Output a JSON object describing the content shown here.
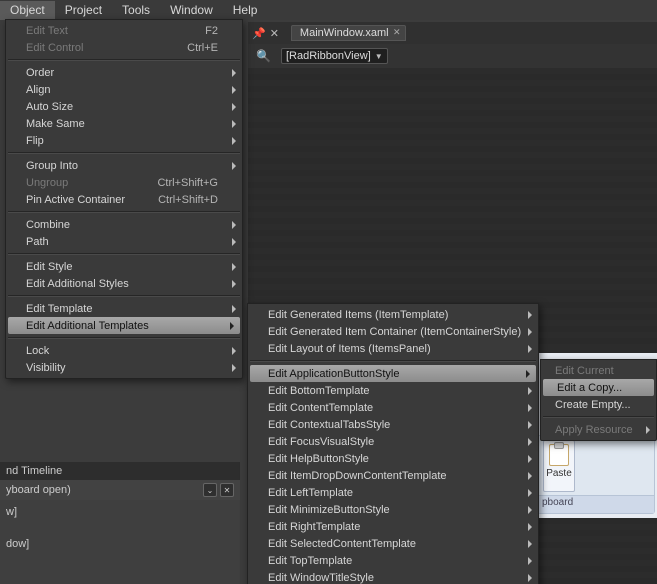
{
  "menubar": {
    "object": "Object",
    "project": "Project",
    "tools": "Tools",
    "window": "Window",
    "help": "Help"
  },
  "doc": {
    "tab_label": "MainWindow.xaml",
    "combo_value": "[RadRibbonView]"
  },
  "object_menu": {
    "edit_text": "Edit Text",
    "edit_text_sc": "F2",
    "edit_control": "Edit Control",
    "edit_control_sc": "Ctrl+E",
    "order": "Order",
    "align": "Align",
    "auto_size": "Auto Size",
    "make_same": "Make Same",
    "flip": "Flip",
    "group_into": "Group Into",
    "ungroup": "Ungroup",
    "ungroup_sc": "Ctrl+Shift+G",
    "pin_active": "Pin Active Container",
    "pin_active_sc": "Ctrl+Shift+D",
    "combine": "Combine",
    "path": "Path",
    "edit_style": "Edit Style",
    "edit_add_styles": "Edit Additional Styles",
    "edit_template": "Edit Template",
    "edit_add_templates": "Edit Additional Templates",
    "lock": "Lock",
    "visibility": "Visibility"
  },
  "templates_submenu": {
    "gen_items": "Edit Generated Items (ItemTemplate)",
    "gen_item_cont": "Edit Generated Item Container (ItemContainerStyle)",
    "layout_items": "Edit Layout of Items (ItemsPanel)",
    "app_button": "Edit ApplicationButtonStyle",
    "bottom": "Edit BottomTemplate",
    "content": "Edit ContentTemplate",
    "context_tabs": "Edit ContextualTabsStyle",
    "focus_visual": "Edit FocusVisualStyle",
    "help_button": "Edit HelpButtonStyle",
    "item_dropdown": "Edit ItemDropDownContentTemplate",
    "left": "Edit LeftTemplate",
    "minimize": "Edit MinimizeButtonStyle",
    "right": "Edit RightTemplate",
    "selected": "Edit SelectedContentTemplate",
    "top": "Edit TopTemplate",
    "window_title": "Edit WindowTitleStyle"
  },
  "style_submenu": {
    "edit_current": "Edit Current",
    "edit_copy": "Edit a Copy...",
    "create_empty": "Create Empty...",
    "apply_resource": "Apply Resource"
  },
  "timeline": {
    "header": "nd Timeline",
    "sub": "yboard open)",
    "row1": "w]",
    "row2": "dow]"
  },
  "ribbon": {
    "paste": "Paste",
    "clipboard": "pboard"
  }
}
